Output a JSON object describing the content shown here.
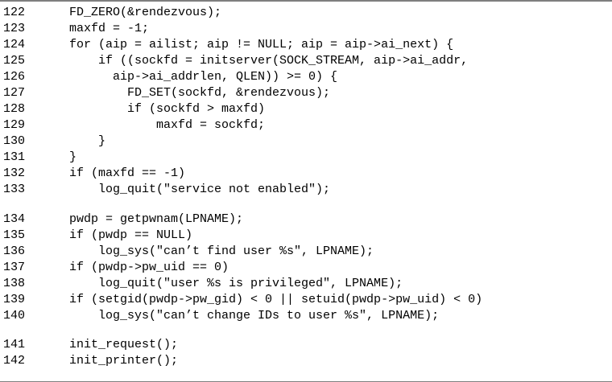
{
  "listing": {
    "lines": [
      {
        "num": "122",
        "code": "FD_ZERO(&rendezvous);"
      },
      {
        "num": "123",
        "code": "maxfd = -1;"
      },
      {
        "num": "124",
        "code": "for (aip = ailist; aip != NULL; aip = aip->ai_next) {"
      },
      {
        "num": "125",
        "code": "    if ((sockfd = initserver(SOCK_STREAM, aip->ai_addr,"
      },
      {
        "num": "126",
        "code": "      aip->ai_addrlen, QLEN)) >= 0) {"
      },
      {
        "num": "127",
        "code": "        FD_SET(sockfd, &rendezvous);"
      },
      {
        "num": "128",
        "code": "        if (sockfd > maxfd)"
      },
      {
        "num": "129",
        "code": "            maxfd = sockfd;"
      },
      {
        "num": "130",
        "code": "    }"
      },
      {
        "num": "131",
        "code": "}"
      },
      {
        "num": "132",
        "code": "if (maxfd == -1)"
      },
      {
        "num": "133",
        "code": "    log_quit(\"service not enabled\");"
      },
      {
        "num": "134",
        "code": "pwdp = getpwnam(LPNAME);"
      },
      {
        "num": "135",
        "code": "if (pwdp == NULL)"
      },
      {
        "num": "136",
        "code": "    log_sys(\"can’t find user %s\", LPNAME);"
      },
      {
        "num": "137",
        "code": "if (pwdp->pw_uid == 0)"
      },
      {
        "num": "138",
        "code": "    log_quit(\"user %s is privileged\", LPNAME);"
      },
      {
        "num": "139",
        "code": "if (setgid(pwdp->pw_gid) < 0 || setuid(pwdp->pw_uid) < 0)"
      },
      {
        "num": "140",
        "code": "    log_sys(\"can’t change IDs to user %s\", LPNAME);"
      },
      {
        "num": "141",
        "code": "init_request();"
      },
      {
        "num": "142",
        "code": "init_printer();"
      }
    ]
  }
}
